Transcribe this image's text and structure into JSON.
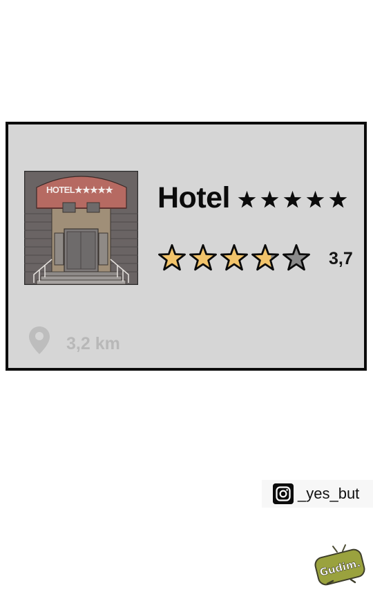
{
  "listing": {
    "name": "Hotel",
    "hotel_class_stars": 5,
    "rating": {
      "value_text": "3,7",
      "value": 3.7,
      "max": 5,
      "filled_color": "#f2c46b",
      "empty_color": "#8a8a8a"
    },
    "distance": {
      "text": "3,2 km",
      "icon": "location-pin-icon"
    },
    "thumbnail": {
      "sign_text": "HOTEL★★★★★"
    }
  },
  "credit": {
    "instagram_handle": "_yes_but",
    "icon": "instagram-icon",
    "signature": "Gudim."
  },
  "colors": {
    "panel_background": "#d6d6d6",
    "panel_border": "#0b0b0b",
    "awning": "#b66a62"
  }
}
